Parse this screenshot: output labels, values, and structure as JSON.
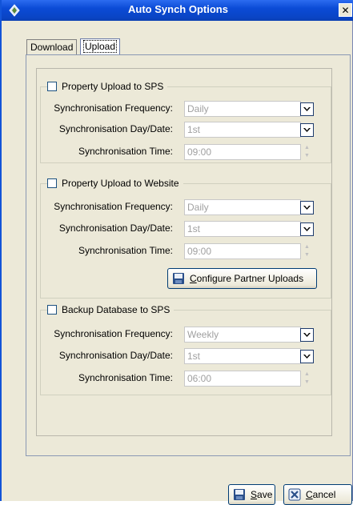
{
  "window": {
    "title": "Auto Synch Options",
    "close_label": "✕"
  },
  "tabs": [
    {
      "label": "Download",
      "active": false
    },
    {
      "label": "Upload",
      "active": true
    }
  ],
  "groups": [
    {
      "title": "Property Upload to SPS",
      "checked": false,
      "frequency_label": "Synchronisation Frequency:",
      "frequency_value": "Daily",
      "day_label": "Synchronisation Day/Date:",
      "day_value": "1st",
      "time_label": "Synchronisation Time:",
      "time_value": "09:00"
    },
    {
      "title": "Property Upload to Website",
      "checked": false,
      "frequency_label": "Synchronisation Frequency:",
      "frequency_value": "Daily",
      "day_label": "Synchronisation Day/Date:",
      "day_value": "1st",
      "time_label": "Synchronisation Time:",
      "time_value": "09:00",
      "configure_first": "C",
      "configure_rest": "onfigure Partner Uploads"
    },
    {
      "title": "Backup Database to SPS",
      "checked": false,
      "frequency_label": "Synchronisation Frequency:",
      "frequency_value": "Weekly",
      "day_label": "Synchronisation Day/Date:",
      "day_value": "1st",
      "time_label": "Synchronisation Time:",
      "time_value": "06:00"
    }
  ],
  "footer": {
    "save_first": "S",
    "save_rest": "ave",
    "cancel_first": "C",
    "cancel_rest": "ancel"
  },
  "colors": {
    "titlebar": "#0b4bd6",
    "window_bg": "#ece9d8",
    "disabled_text": "#a0a0a0"
  }
}
